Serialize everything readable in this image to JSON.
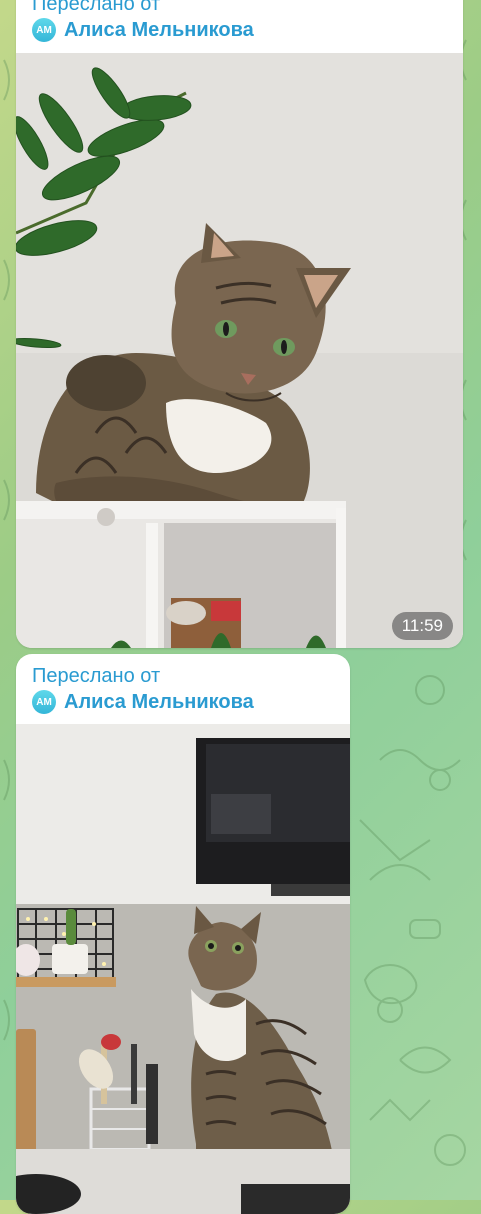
{
  "messages": [
    {
      "forwarded_label": "Переслано от",
      "author_initials": "АМ",
      "author_name": "Алиса Мельникова",
      "time": "11:59"
    },
    {
      "forwarded_label": "Переслано от",
      "author_initials": "АМ",
      "author_name": "Алиса Мельникова"
    }
  ],
  "colors": {
    "accent": "#2a9bd1",
    "avatar": "#3cc0dc",
    "bubble": "#ffffff"
  },
  "icons": {
    "wallpaper": "chat-doodle-pattern"
  }
}
